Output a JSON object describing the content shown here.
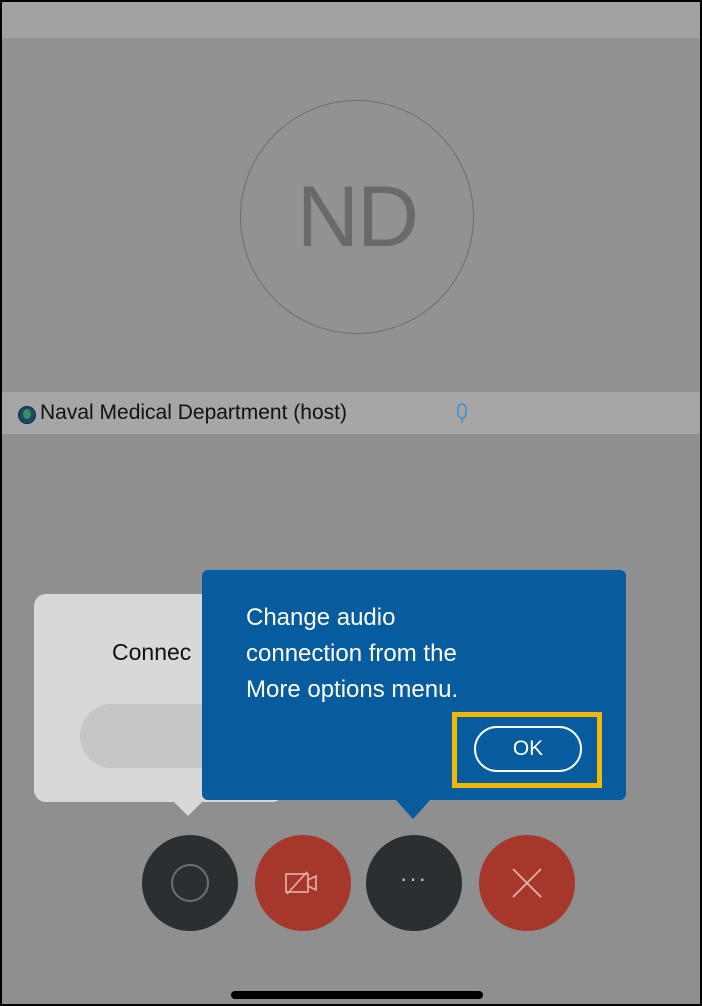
{
  "participant": {
    "initials": "ND",
    "name_label": "Naval Medical Department (host)",
    "icons": {
      "presence": "presence-status-icon",
      "mic": "microphone-icon"
    }
  },
  "connect_popup": {
    "title": "Connec"
  },
  "tooltip": {
    "message": "Change audio\nconnection from the\nMore options menu.",
    "ok_label": "OK"
  },
  "controls": {
    "audio": {
      "icon": "audio-icon"
    },
    "video": {
      "icon": "video-off-icon"
    },
    "more": {
      "icon": "more-options-icon",
      "glyph": "···"
    },
    "end": {
      "icon": "close-icon"
    }
  },
  "colors": {
    "tooltip_bg": "#075b9f",
    "highlight": "#f5b800",
    "danger": "#a5382b",
    "control_dark": "#2c2f31",
    "mic_accent": "#3b8fd1"
  }
}
